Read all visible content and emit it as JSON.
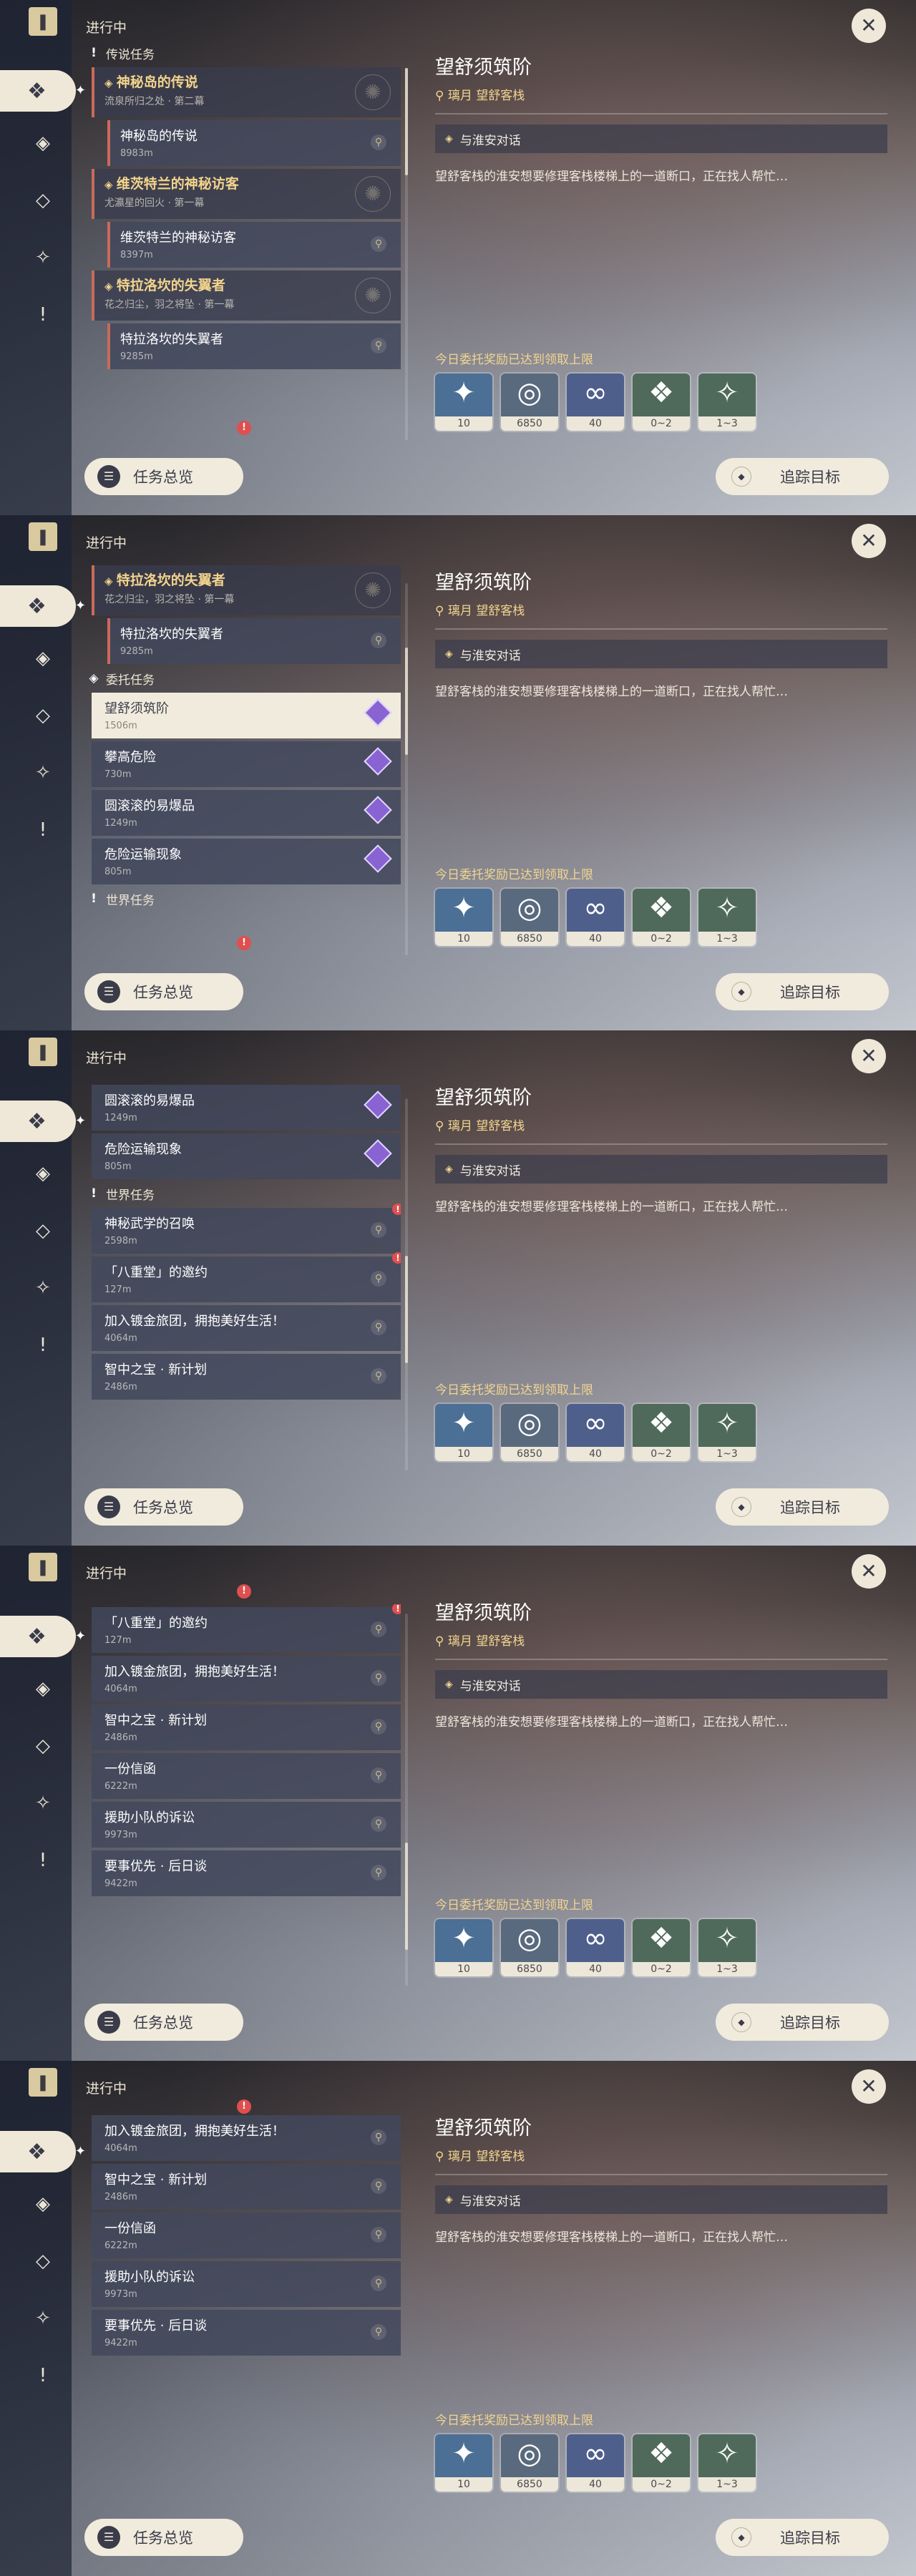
{
  "app": {
    "panel_title": "进行中",
    "close_glyph": "✕",
    "overview_label": "任务总览",
    "track_label": "追踪目标"
  },
  "rail": {
    "icons": [
      "quest-book-icon",
      "four-diamond-icon",
      "compass-icon",
      "commission-diamond-icon",
      "exclamation-icon"
    ]
  },
  "categories": {
    "legend": "传说任务",
    "commission": "委托任务",
    "world": "世界任务"
  },
  "quests": {
    "legend_chapters": [
      {
        "title": "神秘岛的传说",
        "subtitle": "流泉所归之处 · 第二幕",
        "sub": {
          "title": "神秘岛的传说",
          "meta": "8983m"
        }
      },
      {
        "title": "维茨特兰的神秘访客",
        "subtitle": "尤瀛星的回火 · 第一幕",
        "sub": {
          "title": "维茨特兰的神秘访客",
          "meta": "8397m"
        }
      },
      {
        "title": "特拉洛坎的失翼者",
        "subtitle": "花之归尘，羽之将坠 · 第一幕",
        "sub": {
          "title": "特拉洛坎的失翼者",
          "meta": "9285m"
        }
      }
    ],
    "commissions": [
      {
        "title": "望舒须筑阶",
        "meta": "1506m"
      },
      {
        "title": "攀高危险",
        "meta": "730m"
      },
      {
        "title": "圆滚滚的易爆品",
        "meta": "1249m"
      },
      {
        "title": "危险运输现象",
        "meta": "805m"
      }
    ],
    "world": [
      {
        "title": "神秘武学的召唤",
        "meta": "2598m"
      },
      {
        "title": "「八重堂」的邀约",
        "meta": "127m"
      },
      {
        "title": "加入镀金旅团，拥抱美好生活！",
        "meta": "4064m"
      },
      {
        "title": "智中之宝 · 新计划",
        "meta": "2486m"
      },
      {
        "title": "一份信函",
        "meta": "6222m"
      },
      {
        "title": "援助小队的诉讼",
        "meta": "9973m"
      },
      {
        "title": "要事优先 · 后日谈",
        "meta": "9422m"
      }
    ]
  },
  "detail": {
    "title": "望舒须筑阶",
    "location": "璃月  望舒客栈",
    "objective": "与淮安对话",
    "description": "望舒客栈的淮安想要修理客栈楼梯上的一道断口，正在找人帮忙…",
    "reward_title": "今日委托奖励已达到领取上限",
    "rewards": [
      {
        "name": "adventure-exp",
        "glyph": "✦",
        "count": "10",
        "color": "#4b6f95"
      },
      {
        "name": "mora",
        "glyph": "◎",
        "count": "6850",
        "color": "#5a6a7e"
      },
      {
        "name": "companionship-exp",
        "glyph": "∞",
        "count": "40",
        "color": "#4f5f8c"
      },
      {
        "name": "purple-crystal",
        "glyph": "❖",
        "count": "0~2",
        "color": "#4f6a5a"
      },
      {
        "name": "violet-ore",
        "glyph": "✧",
        "count": "1~3",
        "color": "#4f6a5a"
      }
    ]
  },
  "colors": {
    "gold": "#f2d58f",
    "cream": "#f1ebdd",
    "accent_red": "#c96a5a",
    "commission_purple": "#8a63d3",
    "alert": "#e04f4f"
  }
}
